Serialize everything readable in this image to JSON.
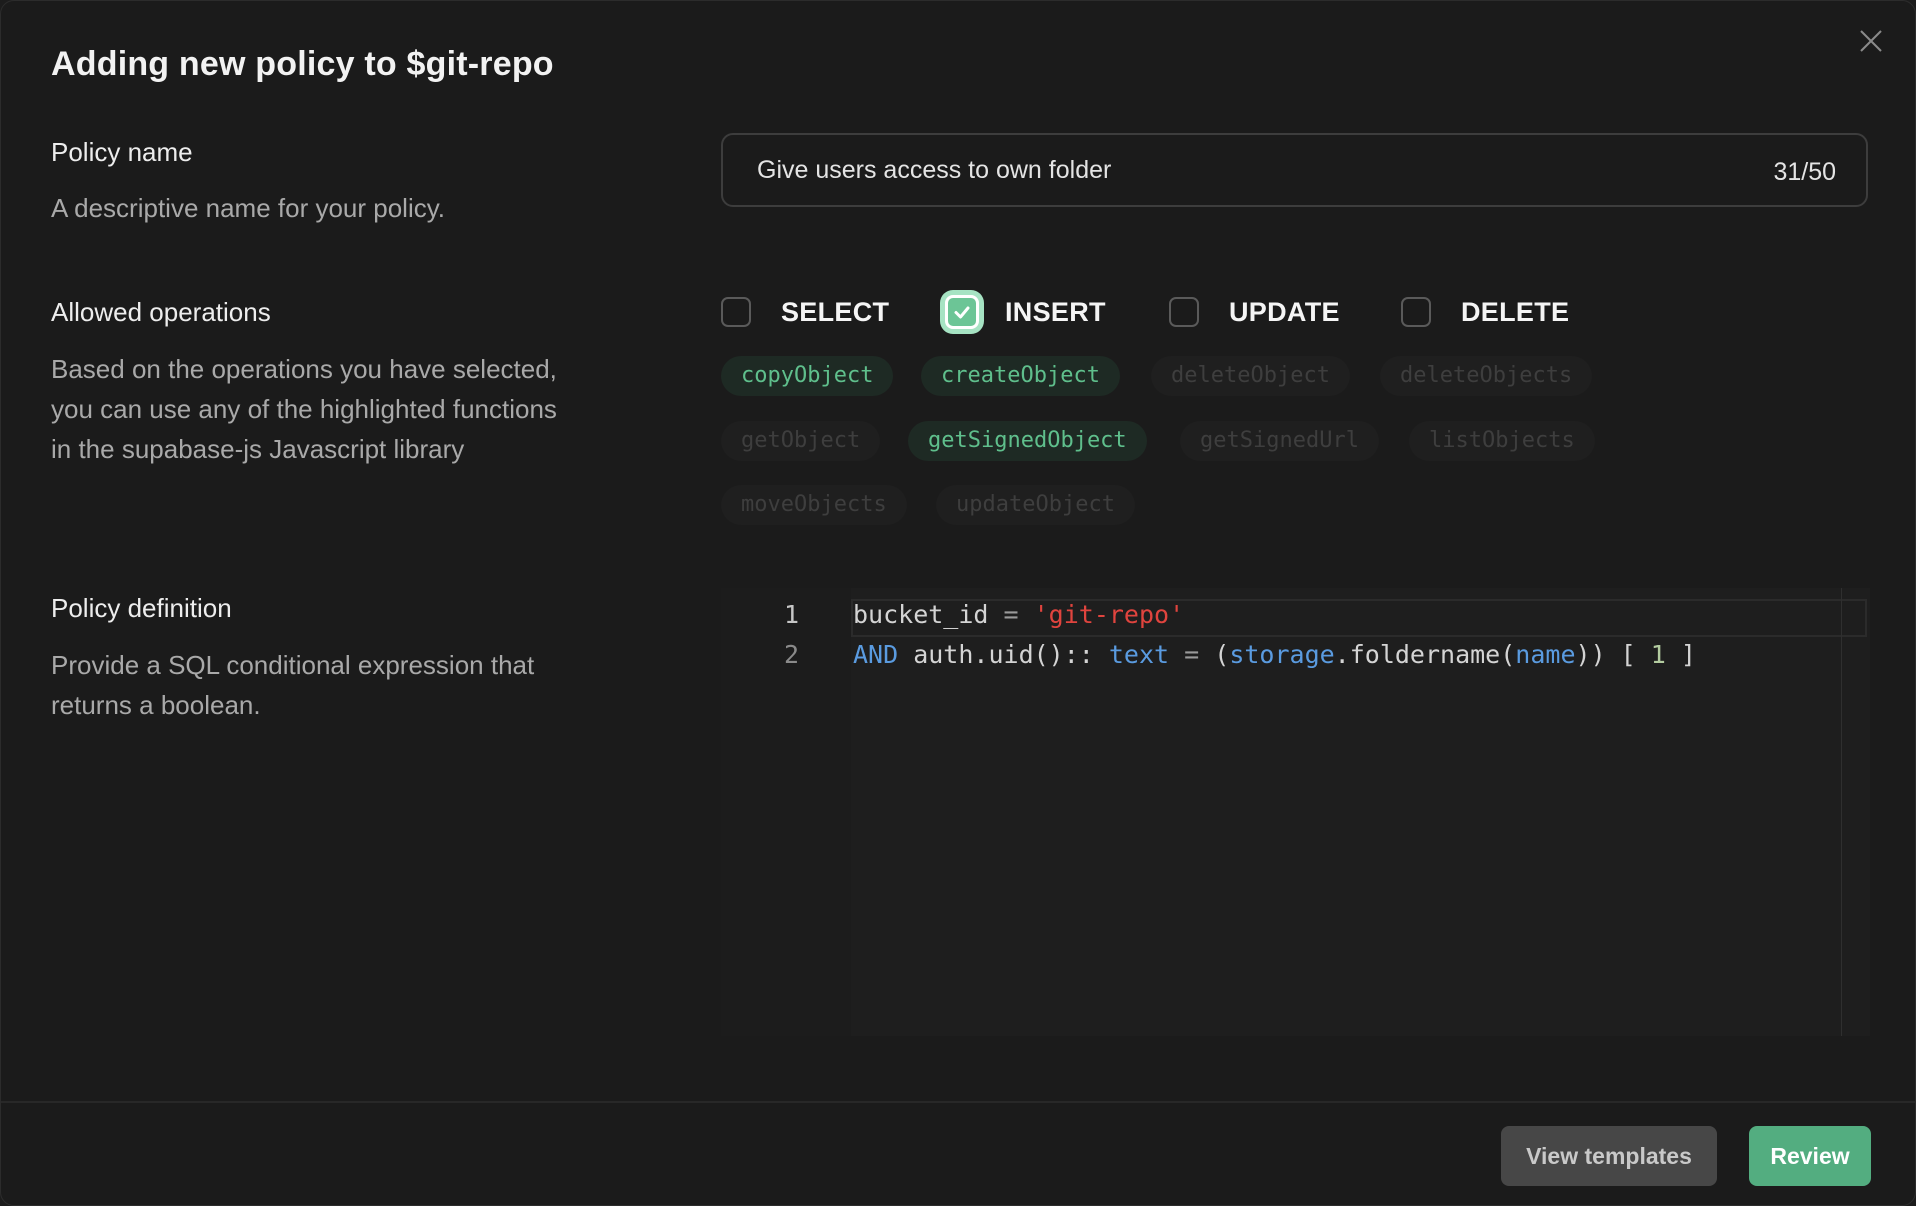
{
  "dialog": {
    "title": "Adding new policy to $git-repo",
    "close_icon": "close-icon"
  },
  "policy_name": {
    "label": "Policy name",
    "description": "A descriptive name for your policy.",
    "value": "Give users access to own folder",
    "char_count": "31/50"
  },
  "allowed_operations": {
    "label": "Allowed operations",
    "description_lines": [
      "Based on the operations you have selected,",
      "you can use any of the highlighted functions",
      "in the supabase-js Javascript library"
    ],
    "operations": [
      {
        "label": "SELECT",
        "checked": false
      },
      {
        "label": "INSERT",
        "checked": true
      },
      {
        "label": "UPDATE",
        "checked": false
      },
      {
        "label": "DELETE",
        "checked": false
      }
    ],
    "functions": [
      {
        "name": "copyObject",
        "highlighted": true
      },
      {
        "name": "createObject",
        "highlighted": true
      },
      {
        "name": "deleteObject",
        "highlighted": false
      },
      {
        "name": "deleteObjects",
        "highlighted": false
      },
      {
        "name": "getObject",
        "highlighted": false
      },
      {
        "name": "getSignedObject",
        "highlighted": true
      },
      {
        "name": "getSignedUrl",
        "highlighted": false
      },
      {
        "name": "listObjects",
        "highlighted": false
      },
      {
        "name": "moveObjects",
        "highlighted": false
      },
      {
        "name": "updateObject",
        "highlighted": false
      }
    ]
  },
  "policy_definition": {
    "label": "Policy definition",
    "description_lines": [
      "Provide a SQL conditional expression that",
      "returns a boolean."
    ],
    "line_numbers": [
      "1",
      "2"
    ],
    "code_lines": [
      [
        {
          "t": "id",
          "v": "bucket_id"
        },
        {
          "t": "op",
          "v": " = "
        },
        {
          "t": "str",
          "v": "'git-repo'"
        }
      ],
      [
        {
          "t": "kw",
          "v": "AND"
        },
        {
          "t": "id",
          "v": " auth.uid():: "
        },
        {
          "t": "kw",
          "v": "text"
        },
        {
          "t": "op",
          "v": " = "
        },
        {
          "t": "id",
          "v": "("
        },
        {
          "t": "kw",
          "v": "storage"
        },
        {
          "t": "id",
          "v": ".foldername("
        },
        {
          "t": "kw",
          "v": "name"
        },
        {
          "t": "id",
          "v": ")) [ "
        },
        {
          "t": "num",
          "v": "1"
        },
        {
          "t": "id",
          "v": " ]"
        }
      ]
    ]
  },
  "footer": {
    "view_templates_label": "View templates",
    "review_label": "Review"
  },
  "colors": {
    "accent": "#53ad80",
    "highlight_chip_text": "#5fbf8c",
    "sql_string": "#e0443e",
    "sql_keyword": "#5a9be0"
  }
}
